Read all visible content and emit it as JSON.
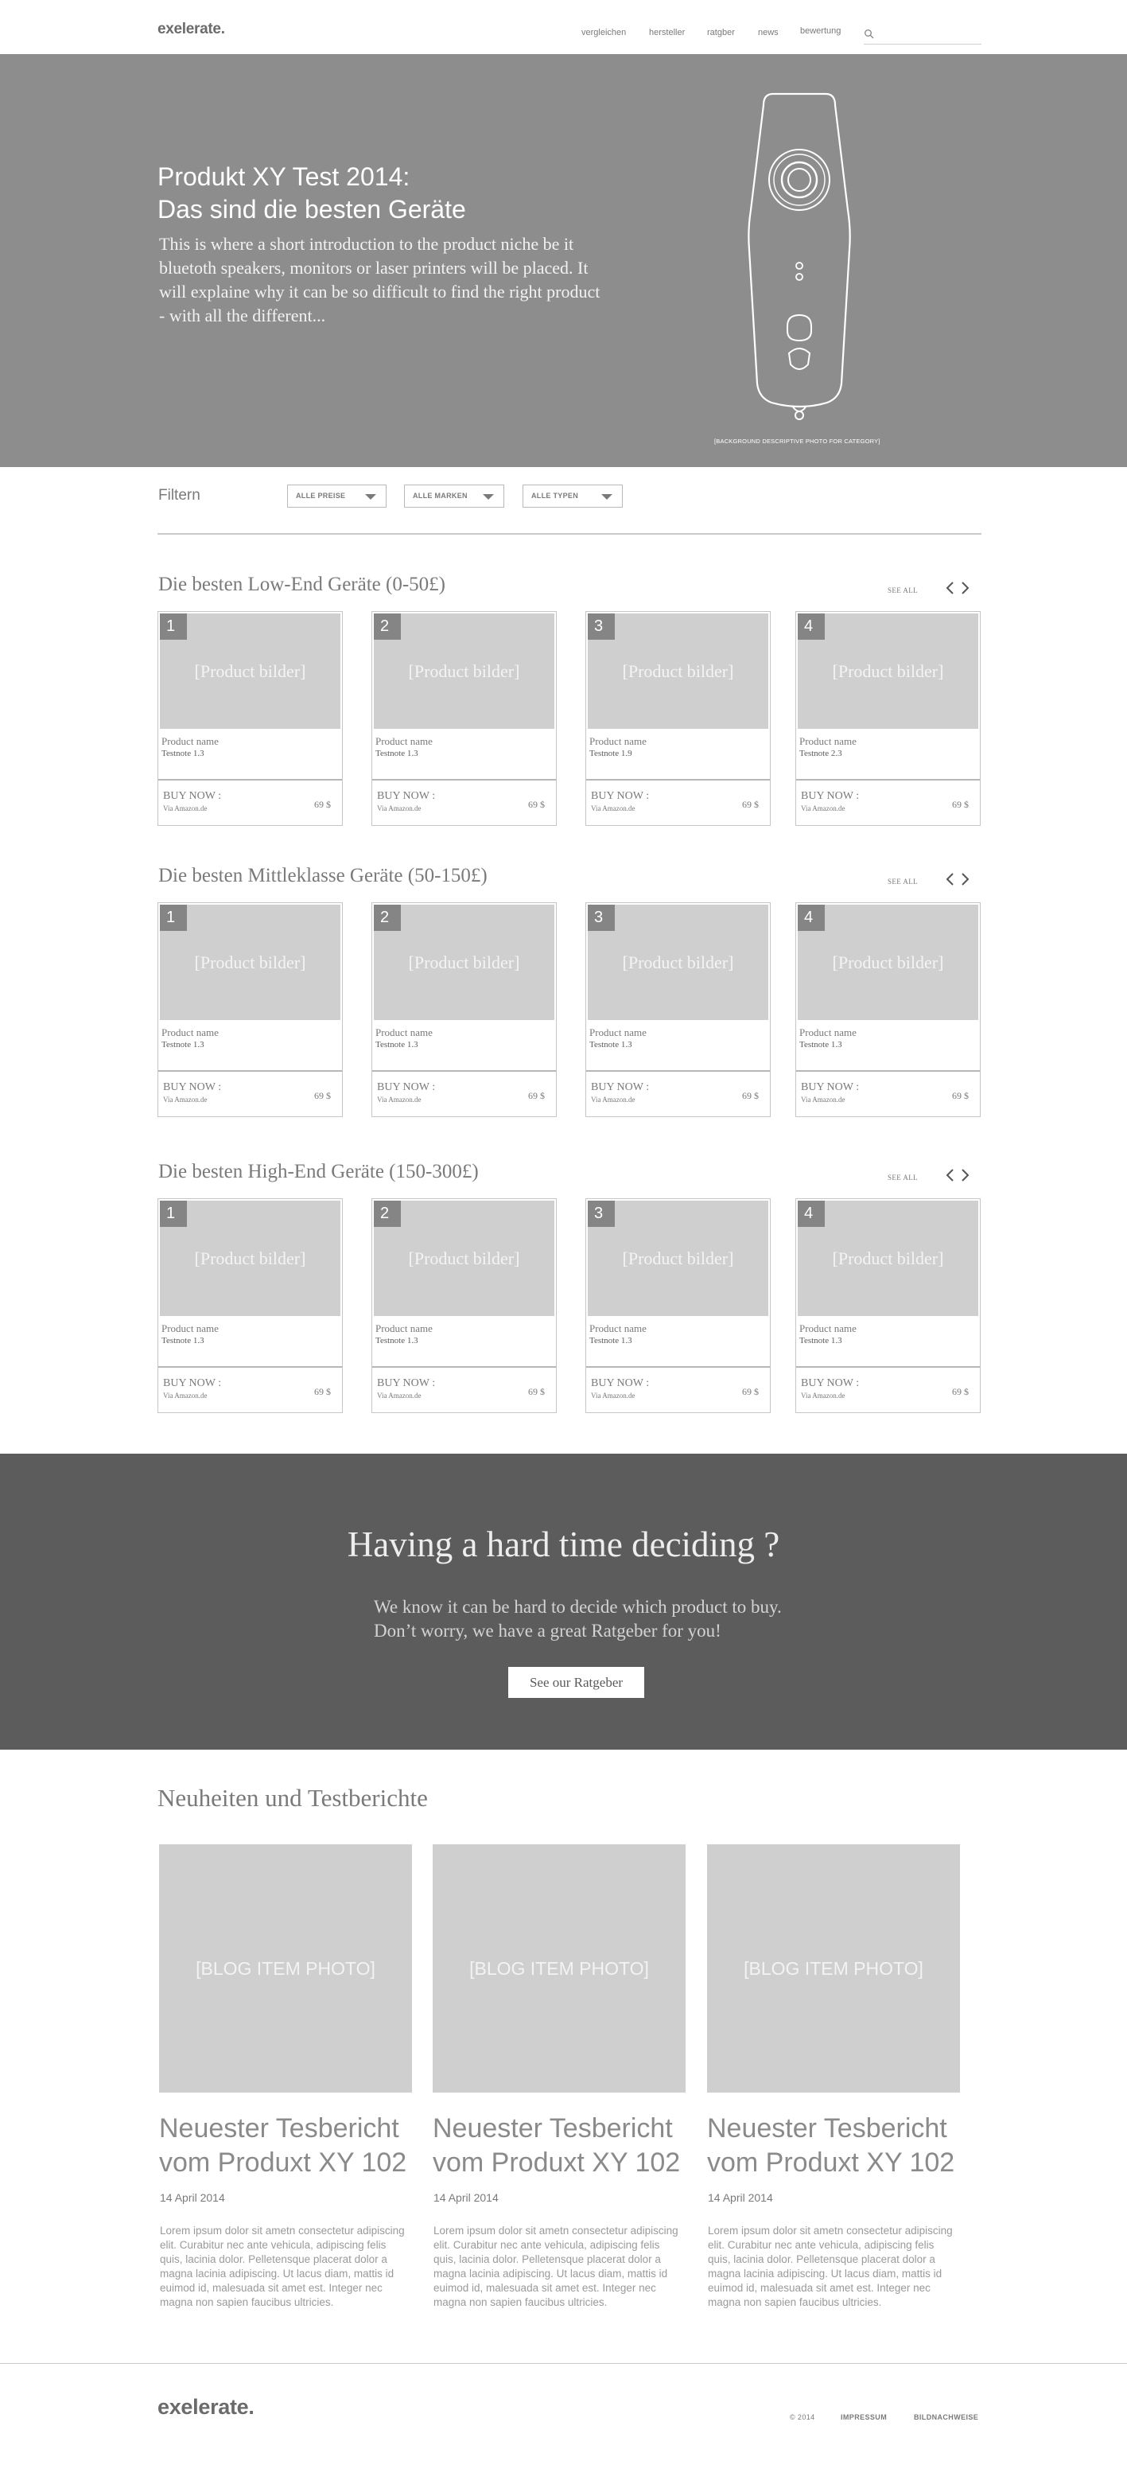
{
  "header": {
    "logo": "exelerate.",
    "nav": [
      {
        "label": "vergleichen"
      },
      {
        "label": "hersteller"
      },
      {
        "label": "ratgber"
      },
      {
        "label": "news"
      },
      {
        "label": "bewertung"
      }
    ],
    "search_placeholder": ""
  },
  "hero": {
    "title_line1": "Produkt XY Test 2014:",
    "title_line2": "Das sind die besten Geräte",
    "intro": "This is where a short introduction to the product niche be it bluetoth speakers, monitors or laser printers will be placed. It will explaine why it can be so difficult to find the right product - with all the different...",
    "caption": "[BACKGROUND DESCRIPTIVE PHOTO FOR CATEGORY]"
  },
  "filter": {
    "label": "Filtern",
    "selects": [
      {
        "label": "ALLE PREISE"
      },
      {
        "label": "ALLE MARKEN"
      },
      {
        "label": "ALLE TYPEN"
      }
    ]
  },
  "sections": [
    {
      "title": "Die besten Low-End Geräte (0-50£)",
      "see_all": "SEE ALL",
      "products": [
        {
          "rank": "1",
          "image_label": "[Product bilder]",
          "name": "Product name",
          "score": "Testnote 1.3",
          "buy": "BUY NOW :",
          "via": "Via Amazon.de",
          "price": "69 $"
        },
        {
          "rank": "2",
          "image_label": "[Product bilder]",
          "name": "Product name",
          "score": "Testnote 1.3",
          "buy": "BUY NOW :",
          "via": "Via Amazon.de",
          "price": "69 $"
        },
        {
          "rank": "3",
          "image_label": "[Product bilder]",
          "name": "Product name",
          "score": "Testnote 1.9",
          "buy": "BUY NOW :",
          "via": "Via Amazon.de",
          "price": "69 $"
        },
        {
          "rank": "4",
          "image_label": "[Product bilder]",
          "name": "Product name",
          "score": "Testnote 2.3",
          "buy": "BUY NOW :",
          "via": "Via Amazon.de",
          "price": "69 $"
        }
      ]
    },
    {
      "title": "Die besten Mittleklasse Geräte (50-150£)",
      "see_all": "SEE ALL",
      "products": [
        {
          "rank": "1",
          "image_label": "[Product bilder]",
          "name": "Product name",
          "score": "Testnote 1.3",
          "buy": "BUY NOW :",
          "via": "Via Amazon.de",
          "price": "69 $"
        },
        {
          "rank": "2",
          "image_label": "[Product bilder]",
          "name": "Product name",
          "score": "Testnote 1.3",
          "buy": "BUY NOW :",
          "via": "Via Amazon.de",
          "price": "69 $"
        },
        {
          "rank": "3",
          "image_label": "[Product bilder]",
          "name": "Product name",
          "score": "Testnote 1.3",
          "buy": "BUY NOW :",
          "via": "Via Amazon.de",
          "price": "69 $"
        },
        {
          "rank": "4",
          "image_label": "[Product bilder]",
          "name": "Product name",
          "score": "Testnote 1.3",
          "buy": "BUY NOW :",
          "via": "Via Amazon.de",
          "price": "69 $"
        }
      ]
    },
    {
      "title": "Die besten High-End Geräte (150-300£)",
      "see_all": "SEE ALL",
      "products": [
        {
          "rank": "1",
          "image_label": "[Product bilder]",
          "name": "Product name",
          "score": "Testnote 1.3",
          "buy": "BUY NOW :",
          "via": "Via Amazon.de",
          "price": "69 $"
        },
        {
          "rank": "2",
          "image_label": "[Product bilder]",
          "name": "Product name",
          "score": "Testnote 1.3",
          "buy": "BUY NOW :",
          "via": "Via Amazon.de",
          "price": "69 $"
        },
        {
          "rank": "3",
          "image_label": "[Product bilder]",
          "name": "Product name",
          "score": "Testnote 1.3",
          "buy": "BUY NOW :",
          "via": "Via Amazon.de",
          "price": "69 $"
        },
        {
          "rank": "4",
          "image_label": "[Product bilder]",
          "name": "Product name",
          "score": "Testnote 1.3",
          "buy": "BUY NOW :",
          "via": "Via Amazon.de",
          "price": "69 $"
        }
      ]
    }
  ],
  "cta": {
    "title": "Having a hard time deciding ?",
    "text_line1": "We know it can be hard to decide which product to buy.",
    "text_line2": "Don’t worry, we have a great Ratgeber for you!",
    "button": "See our Ratgeber"
  },
  "blog": {
    "heading": "Neuheiten und Testberichte",
    "items": [
      {
        "photo_label": "[BLOG ITEM PHOTO]",
        "title": "Neuester Tesbericht vom Produxt XY 102",
        "date": "14 April 2014",
        "body": "Lorem ipsum dolor sit ametn consectetur adipiscing elit. Curabitur nec ante vehicula, adipiscing felis quis, lacinia dolor. Pelletensque placerat dolor a magna lacinia adipiscing. Ut lacus diam, mattis id euimod id, malesuada sit amet est. Integer nec magna non sapien faucibus ultricies."
      },
      {
        "photo_label": "[BLOG ITEM PHOTO]",
        "title": "Neuester Tesbericht vom Produxt XY 102",
        "date": "14 April 2014",
        "body": "Lorem ipsum dolor sit ametn consectetur adipiscing elit. Curabitur nec ante vehicula, adipiscing felis quis, lacinia dolor. Pelletensque placerat dolor a magna lacinia adipiscing. Ut lacus diam, mattis id euimod id, malesuada sit amet est. Integer nec magna non sapien faucibus ultricies."
      },
      {
        "photo_label": "[BLOG ITEM PHOTO]",
        "title": "Neuester Tesbericht vom Produxt XY 102",
        "date": "14 April 2014",
        "body": "Lorem ipsum dolor sit ametn consectetur adipiscing elit. Curabitur nec ante vehicula, adipiscing felis quis, lacinia dolor. Pelletensque placerat dolor a magna lacinia adipiscing. Ut lacus diam, mattis id euimod id, malesuada sit amet est. Integer nec magna non sapien faucibus ultricies."
      }
    ]
  },
  "footer": {
    "logo": "exelerate.",
    "copyright": "© 2014",
    "links": [
      {
        "label": "IMPRESSUM"
      },
      {
        "label": "BILDNACHWEISE"
      }
    ]
  },
  "icons": {
    "search": "search-icon",
    "arrow_left": "chevron-left-icon",
    "arrow_right": "chevron-right-icon",
    "dropdown": "caret-down-icon"
  },
  "colors": {
    "hero_bg": "#8d8d8d",
    "cta_bg": "#5c5c5c",
    "placeholder_gray": "#cfcfcf",
    "rank_badge": "#858585"
  }
}
